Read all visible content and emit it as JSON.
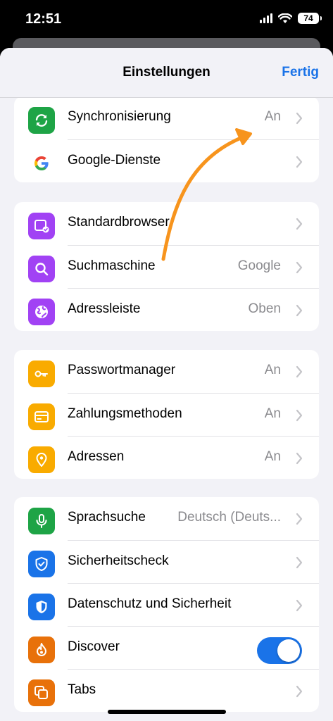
{
  "status_bar": {
    "time": "12:51",
    "battery": "74"
  },
  "nav": {
    "title": "Einstellungen",
    "done_label": "Fertig"
  },
  "groups": [
    {
      "rows": [
        {
          "label": "Synchronisierung",
          "value": "An",
          "icon": "sync-icon",
          "color": "#1ea446"
        },
        {
          "label": "Google-Dienste",
          "value": "",
          "icon": "google-icon",
          "color": "#ffffff"
        }
      ]
    },
    {
      "rows": [
        {
          "label": "Standardbrowser",
          "value": "",
          "icon": "default-browser-icon",
          "color": "#a142f4"
        },
        {
          "label": "Suchmaschine",
          "value": "Google",
          "icon": "search-icon",
          "color": "#a142f4"
        },
        {
          "label": "Adressleiste",
          "value": "Oben",
          "icon": "globe-icon",
          "color": "#a142f4"
        }
      ]
    },
    {
      "rows": [
        {
          "label": "Passwortmanager",
          "value": "An",
          "icon": "key-icon",
          "color": "#f9ab00"
        },
        {
          "label": "Zahlungsmethoden",
          "value": "An",
          "icon": "credit-card-icon",
          "color": "#f9ab00"
        },
        {
          "label": "Adressen",
          "value": "An",
          "icon": "location-pin-icon",
          "color": "#f9ab00"
        }
      ]
    },
    {
      "rows": [
        {
          "label": "Sprachsuche",
          "value": "Deutsch (Deuts...",
          "icon": "microphone-icon",
          "color": "#1ea446"
        },
        {
          "label": "Sicherheitscheck",
          "value": "",
          "icon": "shield-check-icon",
          "color": "#1a73e8"
        },
        {
          "label": "Datenschutz und Sicherheit",
          "value": "",
          "icon": "privacy-shield-icon",
          "color": "#1a73e8"
        },
        {
          "label": "Discover",
          "value": "",
          "icon": "flame-icon",
          "color": "#e8710a",
          "toggle_on": true
        },
        {
          "label": "Tabs",
          "value": "",
          "icon": "tabs-icon",
          "color": "#e8710a"
        }
      ]
    }
  ],
  "annotation": {
    "arrow_color": "#f7941d"
  }
}
